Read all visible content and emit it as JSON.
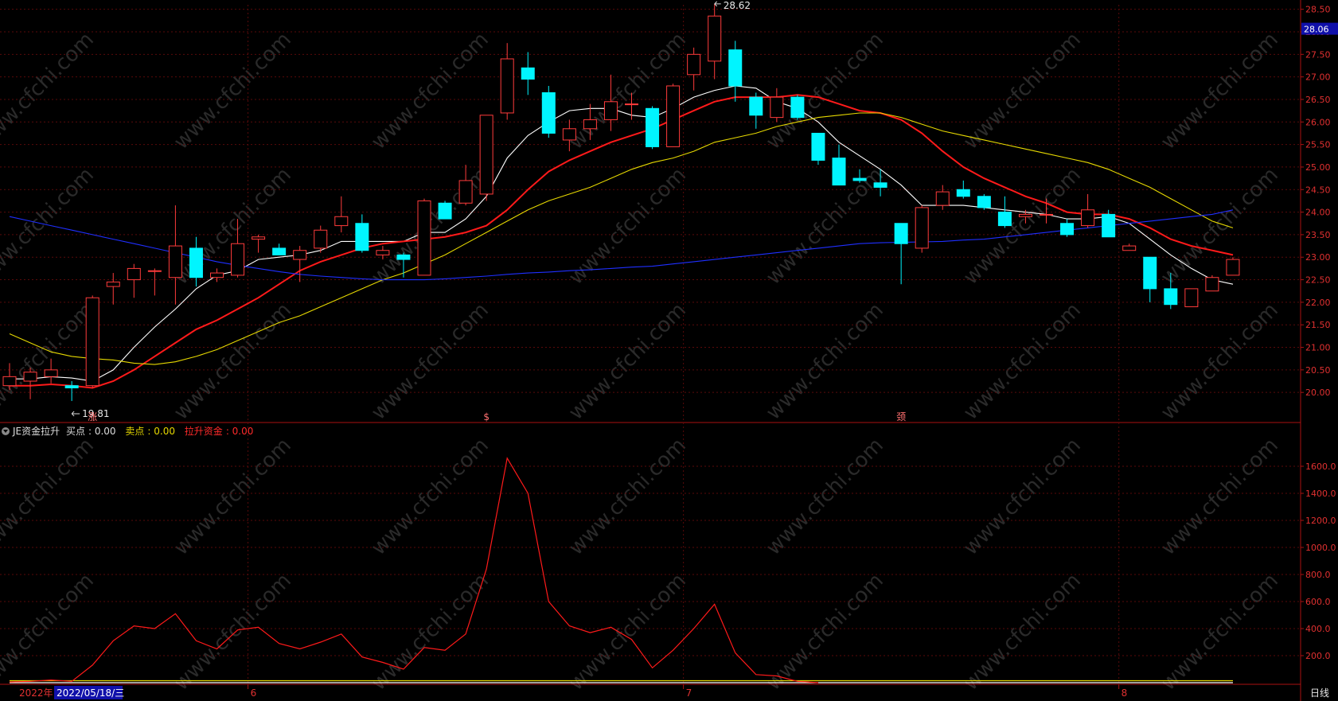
{
  "chart_data": [
    {
      "type": "candlestick",
      "period_label": "日线",
      "current_price_badge": "28.06",
      "y_ticks": [
        "20.00",
        "20.50",
        "21.00",
        "21.50",
        "22.00",
        "22.50",
        "23.00",
        "23.50",
        "24.00",
        "24.50",
        "25.00",
        "25.50",
        "26.00",
        "26.50",
        "27.00",
        "27.50",
        "28.00",
        "28.50"
      ],
      "ylim": [
        19.35,
        28.6
      ],
      "annotations": {
        "max_label": "28.62",
        "min_label": "19.81"
      },
      "markers": [
        {
          "index": 4,
          "text": "涨"
        },
        {
          "index": 23,
          "text": "$"
        },
        {
          "index": 43,
          "text": "颈"
        }
      ],
      "candles": [
        {
          "o": 20.15,
          "h": 20.65,
          "l": 20.05,
          "c": 20.35
        },
        {
          "o": 20.25,
          "h": 20.55,
          "l": 19.85,
          "c": 20.45
        },
        {
          "o": 20.35,
          "h": 20.75,
          "l": 20.2,
          "c": 20.5
        },
        {
          "o": 20.15,
          "h": 20.25,
          "l": 19.81,
          "c": 20.1
        },
        {
          "o": 20.15,
          "h": 22.15,
          "l": 20.1,
          "c": 22.1
        },
        {
          "o": 22.35,
          "h": 22.65,
          "l": 21.95,
          "c": 22.45
        },
        {
          "o": 22.5,
          "h": 22.85,
          "l": 22.1,
          "c": 22.75
        },
        {
          "o": 22.7,
          "h": 22.75,
          "l": 22.15,
          "c": 22.7
        },
        {
          "o": 22.55,
          "h": 24.15,
          "l": 21.95,
          "c": 23.25
        },
        {
          "o": 23.2,
          "h": 23.45,
          "l": 22.35,
          "c": 22.55
        },
        {
          "o": 22.55,
          "h": 22.75,
          "l": 22.45,
          "c": 22.65
        },
        {
          "o": 22.6,
          "h": 23.85,
          "l": 22.55,
          "c": 23.3
        },
        {
          "o": 23.4,
          "h": 23.5,
          "l": 23.1,
          "c": 23.45
        },
        {
          "o": 23.2,
          "h": 23.3,
          "l": 23.05,
          "c": 23.05
        },
        {
          "o": 22.95,
          "h": 23.25,
          "l": 22.45,
          "c": 23.15
        },
        {
          "o": 23.2,
          "h": 23.7,
          "l": 23.1,
          "c": 23.6
        },
        {
          "o": 23.7,
          "h": 24.35,
          "l": 23.55,
          "c": 23.9
        },
        {
          "o": 23.75,
          "h": 23.95,
          "l": 23.1,
          "c": 23.15
        },
        {
          "o": 23.05,
          "h": 23.25,
          "l": 22.95,
          "c": 23.15
        },
        {
          "o": 23.05,
          "h": 23.1,
          "l": 22.55,
          "c": 22.95
        },
        {
          "o": 22.6,
          "h": 24.3,
          "l": 22.6,
          "c": 24.25
        },
        {
          "o": 24.2,
          "h": 24.25,
          "l": 23.85,
          "c": 23.85
        },
        {
          "o": 24.2,
          "h": 25.05,
          "l": 24.15,
          "c": 24.7
        },
        {
          "o": 24.4,
          "h": 25.45,
          "l": 24.25,
          "c": 26.15
        },
        {
          "o": 26.2,
          "h": 27.75,
          "l": 26.05,
          "c": 27.4
        },
        {
          "o": 27.2,
          "h": 27.55,
          "l": 26.6,
          "c": 26.95
        },
        {
          "o": 26.65,
          "h": 26.8,
          "l": 25.65,
          "c": 25.75
        },
        {
          "o": 25.6,
          "h": 26.05,
          "l": 25.35,
          "c": 25.85
        },
        {
          "o": 25.85,
          "h": 26.4,
          "l": 25.6,
          "c": 26.05
        },
        {
          "o": 26.05,
          "h": 27.05,
          "l": 25.8,
          "c": 26.45
        },
        {
          "o": 26.4,
          "h": 26.65,
          "l": 26.05,
          "c": 26.4
        },
        {
          "o": 26.3,
          "h": 26.35,
          "l": 25.4,
          "c": 25.45
        },
        {
          "o": 25.45,
          "h": 26.85,
          "l": 25.45,
          "c": 26.8
        },
        {
          "o": 27.05,
          "h": 27.65,
          "l": 26.7,
          "c": 27.5
        },
        {
          "o": 27.35,
          "h": 28.62,
          "l": 26.95,
          "c": 28.35
        },
        {
          "o": 27.6,
          "h": 27.8,
          "l": 26.45,
          "c": 26.8
        },
        {
          "o": 26.55,
          "h": 26.65,
          "l": 25.85,
          "c": 26.15
        },
        {
          "o": 26.1,
          "h": 26.75,
          "l": 26.0,
          "c": 26.55
        },
        {
          "o": 26.55,
          "h": 26.6,
          "l": 26.05,
          "c": 26.1
        },
        {
          "o": 25.75,
          "h": 25.75,
          "l": 25.05,
          "c": 25.15
        },
        {
          "o": 25.2,
          "h": 25.5,
          "l": 24.6,
          "c": 24.6
        },
        {
          "o": 24.75,
          "h": 24.95,
          "l": 24.65,
          "c": 24.7
        },
        {
          "o": 24.65,
          "h": 24.95,
          "l": 24.35,
          "c": 24.55
        },
        {
          "o": 23.75,
          "h": 23.75,
          "l": 22.4,
          "c": 23.3
        },
        {
          "o": 23.2,
          "h": 24.15,
          "l": 23.1,
          "c": 24.1
        },
        {
          "o": 24.15,
          "h": 24.6,
          "l": 24.05,
          "c": 24.45
        },
        {
          "o": 24.5,
          "h": 24.7,
          "l": 24.3,
          "c": 24.35
        },
        {
          "o": 24.35,
          "h": 24.4,
          "l": 24.05,
          "c": 24.1
        },
        {
          "o": 24.0,
          "h": 24.35,
          "l": 23.65,
          "c": 23.7
        },
        {
          "o": 23.9,
          "h": 24.05,
          "l": 23.75,
          "c": 23.95
        },
        {
          "o": 23.95,
          "h": 24.3,
          "l": 23.75,
          "c": 23.95
        },
        {
          "o": 23.75,
          "h": 23.85,
          "l": 23.45,
          "c": 23.5
        },
        {
          "o": 23.7,
          "h": 24.4,
          "l": 23.65,
          "c": 24.05
        },
        {
          "o": 23.95,
          "h": 24.05,
          "l": 23.45,
          "c": 23.45
        },
        {
          "o": 23.15,
          "h": 23.3,
          "l": 23.15,
          "c": 23.25
        },
        {
          "o": 23.0,
          "h": 23.0,
          "l": 22.0,
          "c": 22.3
        },
        {
          "o": 22.3,
          "h": 22.65,
          "l": 21.85,
          "c": 21.95
        },
        {
          "o": 21.9,
          "h": 22.3,
          "l": 21.9,
          "c": 22.3
        },
        {
          "o": 22.25,
          "h": 22.6,
          "l": 22.25,
          "c": 22.55
        },
        {
          "o": 22.6,
          "h": 23.0,
          "l": 22.6,
          "c": 22.95
        }
      ],
      "series": [
        {
          "color": "#ffffff",
          "values": [
            20.3,
            20.3,
            20.35,
            20.32,
            20.25,
            20.5,
            21.0,
            21.45,
            21.85,
            22.3,
            22.6,
            22.7,
            22.95,
            23.0,
            23.05,
            23.15,
            23.35,
            23.35,
            23.35,
            23.35,
            23.55,
            23.55,
            23.85,
            24.35,
            25.2,
            25.7,
            26.0,
            26.25,
            26.3,
            26.3,
            26.15,
            26.1,
            26.3,
            26.55,
            26.7,
            26.8,
            26.75,
            26.45,
            26.3,
            26.0,
            25.55,
            25.25,
            24.95,
            24.6,
            24.15,
            24.15,
            24.15,
            24.1,
            24.05,
            24.0,
            23.95,
            23.85,
            23.85,
            23.9,
            23.75,
            23.4,
            23.05,
            22.75,
            22.5,
            22.4
          ]
        },
        {
          "color": "#ff1a1a",
          "values": [
            20.15,
            20.15,
            20.18,
            20.15,
            20.1,
            20.25,
            20.5,
            20.8,
            21.1,
            21.4,
            21.6,
            21.85,
            22.1,
            22.4,
            22.7,
            22.9,
            23.05,
            23.2,
            23.3,
            23.35,
            23.4,
            23.45,
            23.55,
            23.7,
            24.05,
            24.5,
            24.9,
            25.15,
            25.35,
            25.55,
            25.7,
            25.85,
            26.05,
            26.25,
            26.45,
            26.55,
            26.55,
            26.55,
            26.6,
            26.55,
            26.4,
            26.25,
            26.2,
            26.05,
            25.75,
            25.35,
            25.0,
            24.75,
            24.55,
            24.35,
            24.2,
            24.0,
            23.95,
            23.95,
            23.85,
            23.65,
            23.4,
            23.25,
            23.15,
            23.05
          ]
        },
        {
          "color": "#e6d800",
          "values": [
            21.3,
            21.1,
            20.9,
            20.8,
            20.75,
            20.72,
            20.65,
            20.62,
            20.68,
            20.8,
            20.95,
            21.15,
            21.35,
            21.55,
            21.7,
            21.9,
            22.1,
            22.3,
            22.5,
            22.65,
            22.85,
            23.05,
            23.3,
            23.55,
            23.8,
            24.05,
            24.25,
            24.4,
            24.55,
            24.75,
            24.95,
            25.1,
            25.2,
            25.35,
            25.55,
            25.65,
            25.75,
            25.9,
            26.0,
            26.1,
            26.15,
            26.2,
            26.2,
            26.1,
            25.95,
            25.8,
            25.7,
            25.6,
            25.5,
            25.4,
            25.3,
            25.2,
            25.1,
            24.95,
            24.75,
            24.55,
            24.3,
            24.05,
            23.8,
            23.65
          ]
        },
        {
          "color": "#1f2fff",
          "values": [
            23.9,
            23.8,
            23.7,
            23.6,
            23.5,
            23.4,
            23.3,
            23.2,
            23.1,
            23.0,
            22.9,
            22.82,
            22.75,
            22.68,
            22.62,
            22.58,
            22.55,
            22.52,
            22.5,
            22.5,
            22.5,
            22.52,
            22.55,
            22.58,
            22.62,
            22.65,
            22.67,
            22.7,
            22.72,
            22.75,
            22.78,
            22.8,
            22.85,
            22.9,
            22.95,
            23.0,
            23.05,
            23.1,
            23.15,
            23.2,
            23.25,
            23.3,
            23.32,
            23.33,
            23.34,
            23.35,
            23.38,
            23.4,
            23.45,
            23.5,
            23.55,
            23.6,
            23.65,
            23.7,
            23.75,
            23.8,
            23.85,
            23.9,
            23.95,
            24.05
          ]
        }
      ]
    },
    {
      "type": "line",
      "indicator_name": "JE资金拉升",
      "ylim": [
        0,
        1800
      ],
      "y_ticks": [
        "200.0",
        "400.0",
        "600.0",
        "800.0",
        "1000.0",
        "1200.0",
        "1400.0",
        "1600.0"
      ],
      "series": [
        {
          "name": "买点",
          "value_label": "0.00",
          "color": "#ffffff",
          "values": [
            0,
            0,
            0,
            0,
            0,
            0,
            0,
            0,
            0,
            0,
            0,
            0,
            0,
            0,
            0,
            0,
            0,
            0,
            0,
            0,
            0,
            0,
            0,
            0,
            0,
            0,
            0,
            0,
            0,
            0,
            0,
            0,
            0,
            0,
            0,
            0,
            0,
            0,
            0,
            0,
            0,
            0,
            0,
            0,
            0,
            0,
            0,
            0,
            0,
            0,
            0,
            0,
            0,
            0,
            0,
            0,
            0,
            0,
            0,
            0
          ]
        },
        {
          "name": "卖点",
          "value_label": "0.00",
          "color": "#e6d800",
          "values": [
            15,
            15,
            15,
            15,
            15,
            15,
            15,
            15,
            15,
            15,
            15,
            15,
            15,
            15,
            15,
            15,
            15,
            15,
            15,
            15,
            15,
            15,
            15,
            15,
            15,
            15,
            15,
            15,
            15,
            15,
            15,
            15,
            15,
            15,
            15,
            15,
            15,
            15,
            15,
            15,
            15,
            15,
            15,
            15,
            15,
            15,
            15,
            15,
            15,
            15,
            15,
            15,
            15,
            15,
            15,
            15,
            15,
            15,
            15,
            15
          ]
        },
        {
          "name": "拉升资金",
          "value_label": "0.00",
          "color": "#ff1a1a",
          "values": [
            5,
            10,
            20,
            10,
            130,
            310,
            420,
            400,
            510,
            310,
            250,
            390,
            410,
            290,
            250,
            300,
            360,
            190,
            150,
            100,
            260,
            240,
            360,
            840,
            1660,
            1400,
            600,
            420,
            370,
            410,
            320,
            110,
            240,
            400,
            580,
            220,
            60,
            50,
            10,
            0,
            null,
            null,
            null,
            null,
            null,
            null,
            null,
            null,
            null,
            null,
            null,
            null,
            null,
            null,
            null,
            null,
            null,
            null,
            null,
            null
          ]
        }
      ]
    }
  ],
  "x_axis": {
    "year_label": "2022年",
    "cursor_date": "2022/05/18/三",
    "month_ticks": [
      {
        "index": 12,
        "label": "6"
      },
      {
        "index": 33,
        "label": "7"
      },
      {
        "index": 54,
        "label": "8"
      }
    ]
  },
  "watermark": "www.cfchi.com"
}
